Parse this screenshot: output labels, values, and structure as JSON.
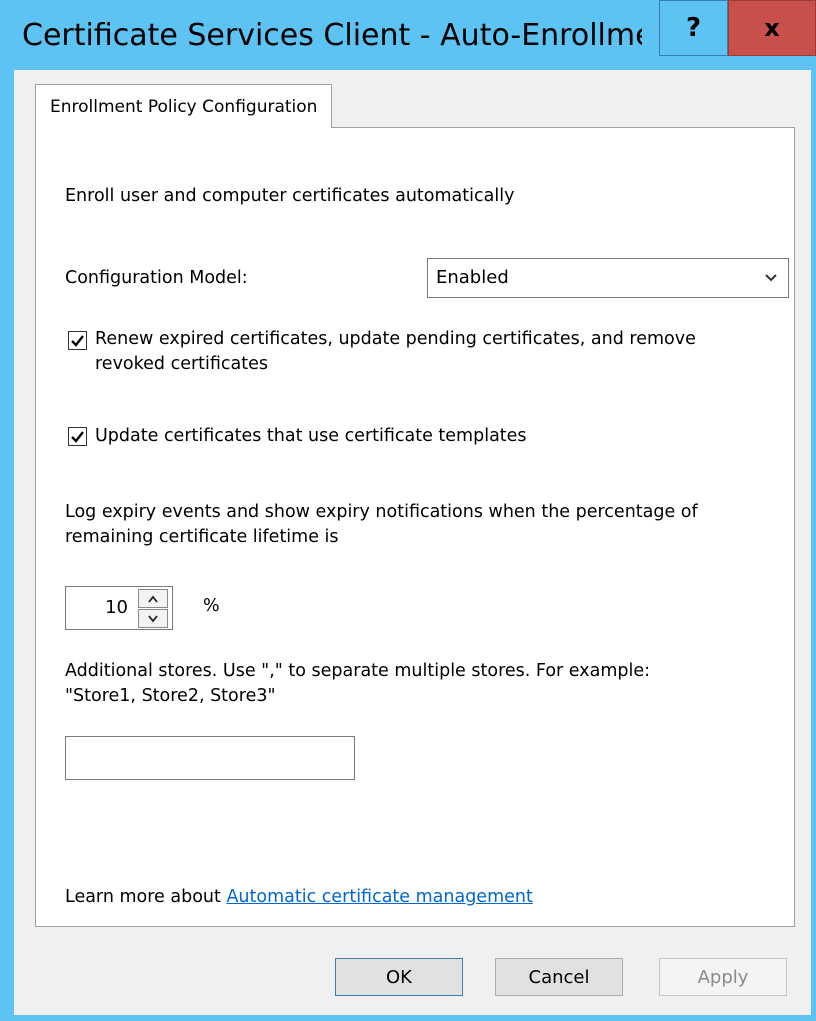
{
  "window": {
    "title": "Certificate Services Client - Auto-Enrollment Pro…",
    "help_label": "?",
    "close_label": "x"
  },
  "tab": {
    "label": "Enrollment Policy Configuration"
  },
  "panel": {
    "heading": "Enroll user and computer certificates automatically",
    "config_model_label": "Configuration Model:",
    "config_model_value": "Enabled",
    "renew_checkbox": {
      "checked": true,
      "line1": "Renew expired certificates, update pending certificates, and remove",
      "line2": "revoked certificates"
    },
    "update_checkbox": {
      "checked": true,
      "label": "Update certificates that use certificate templates"
    },
    "expiry_text_line1": "Log expiry events and show expiry notifications when the percentage of",
    "expiry_text_line2": "remaining certificate lifetime is",
    "expiry_percent": "10",
    "percent_sign": "%",
    "stores_text_line1": "Additional stores. Use \",\" to separate multiple stores. For example:",
    "stores_text_line2": "\"Store1, Store2, Store3\"",
    "stores_value": "",
    "learn_more_prefix": "Learn more about ",
    "learn_more_link": "Automatic certificate management"
  },
  "buttons": {
    "ok": "OK",
    "cancel": "Cancel",
    "apply": "Apply"
  }
}
